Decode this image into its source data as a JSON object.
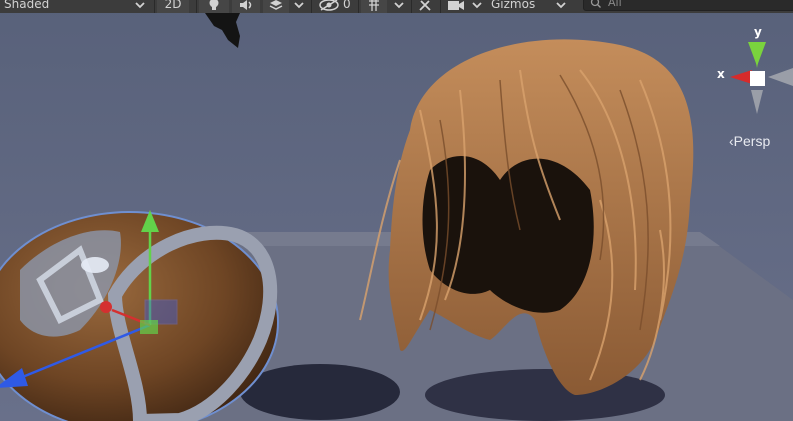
{
  "toolbar": {
    "shading_mode": "Shaded",
    "mode_2d": "2D",
    "hidden_count": "0",
    "gizmos_label": "Gizmos",
    "search_placeholder": "All"
  },
  "scene": {
    "projection_label": "‹Persp",
    "axis_x": "x",
    "axis_y": "y"
  },
  "colors": {
    "sky": "#5a6277",
    "ground": "#6e7386",
    "toolbar_bg": "#3c3c3c",
    "axis_x": "#d62b2b",
    "axis_y": "#7ad33d",
    "axis_z": "#3b5bd6",
    "hair": "#b07a4a"
  },
  "icons": [
    "chevron-down-icon",
    "lightbulb-icon",
    "audio-icon",
    "effects-layers-icon",
    "scene-visibility-icon",
    "grid-snap-icon",
    "tools-icon",
    "camera-icon",
    "search-icon"
  ]
}
